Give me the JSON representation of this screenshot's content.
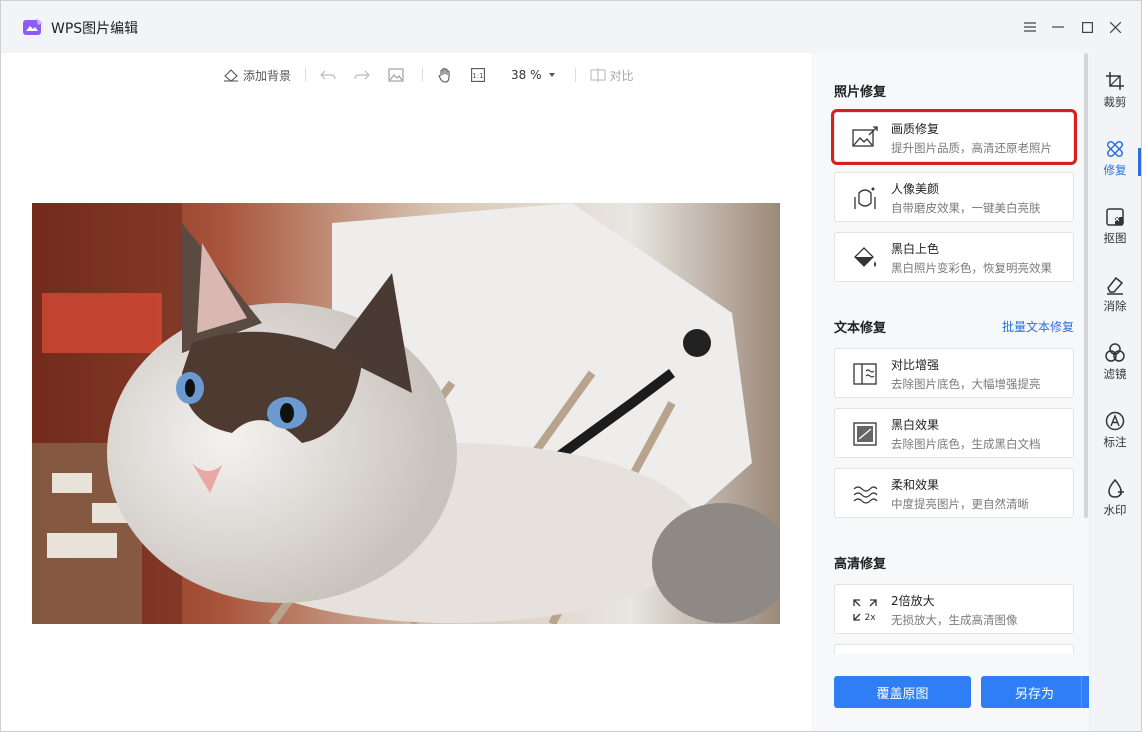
{
  "app": {
    "title": "WPS图片编辑"
  },
  "toolbar": {
    "add_background": "添加背景",
    "zoom": "38 %",
    "compare": "对比",
    "fit_label": "1:1"
  },
  "panel": {
    "photo_repair": {
      "title": "照片修复",
      "items": [
        {
          "title": "画质修复",
          "desc": "提升图片品质，高清还原老照片",
          "icon": "image-enhance-icon"
        },
        {
          "title": "人像美颜",
          "desc": "自带磨皮效果，一键美白亮肤",
          "icon": "portrait-beauty-icon"
        },
        {
          "title": "黑白上色",
          "desc": "黑白照片变彩色，恢复明亮效果",
          "icon": "colorize-icon"
        }
      ]
    },
    "text_repair": {
      "title": "文本修复",
      "link": "批量文本修复",
      "items": [
        {
          "title": "对比增强",
          "desc": "去除图片底色，大幅增强提亮",
          "icon": "contrast-enhance-icon"
        },
        {
          "title": "黑白效果",
          "desc": "去除图片底色，生成黑白文档",
          "icon": "bw-effect-icon"
        },
        {
          "title": "柔和效果",
          "desc": "中度提亮图片，更自然清晰",
          "icon": "soft-effect-icon"
        }
      ]
    },
    "hd_repair": {
      "title": "高清修复",
      "items": [
        {
          "title": "2倍放大",
          "desc": "无损放大，生成高清图像",
          "icon": "upscale-2x-icon"
        }
      ]
    },
    "buttons": {
      "overwrite": "覆盖原图",
      "save_as": "另存为"
    }
  },
  "rail": {
    "items": [
      {
        "label": "裁剪",
        "icon": "crop-icon"
      },
      {
        "label": "修复",
        "icon": "repair-icon",
        "active": true
      },
      {
        "label": "抠图",
        "icon": "cutout-icon"
      },
      {
        "label": "消除",
        "icon": "eraser-icon"
      },
      {
        "label": "滤镜",
        "icon": "filter-icon"
      },
      {
        "label": "标注",
        "icon": "annotate-icon"
      },
      {
        "label": "水印",
        "icon": "watermark-icon"
      }
    ]
  },
  "colors": {
    "accent": "#2f7ef6",
    "highlight_border": "#d81e1e",
    "link": "#2a6fe0"
  }
}
